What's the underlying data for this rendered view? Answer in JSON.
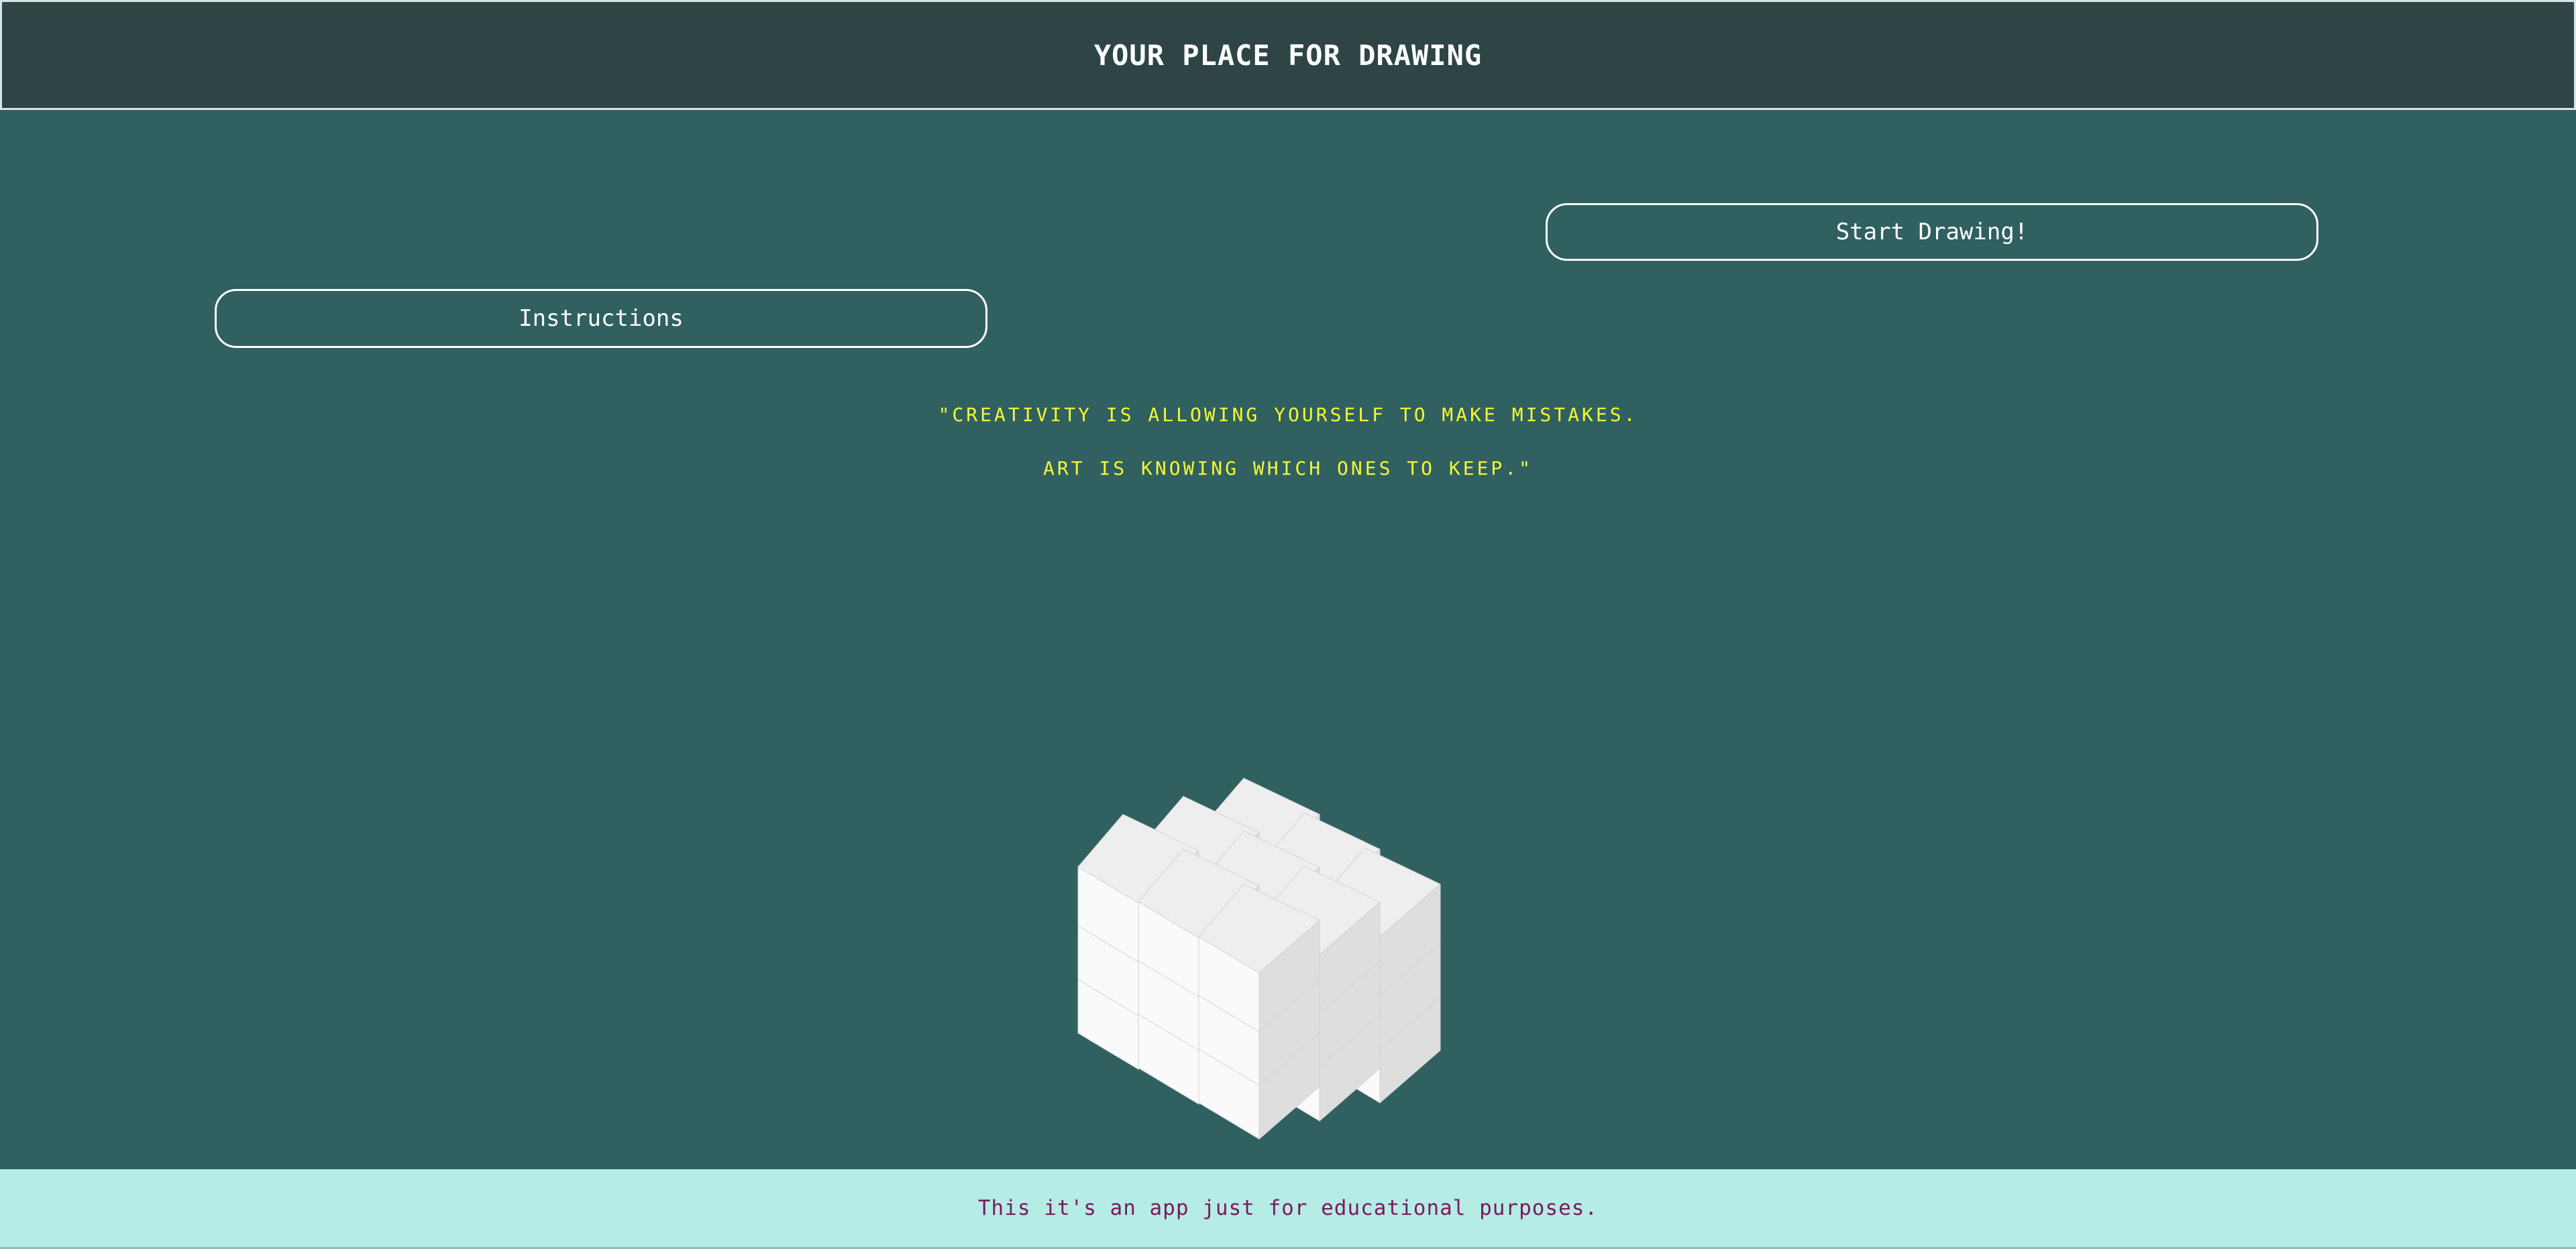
{
  "header": {
    "title": "YOUR PLACE FOR DRAWING"
  },
  "main": {
    "start_button_label": "Start Drawing!",
    "instructions_button_label": "Instructions",
    "quote_line_1": "\"CREATIVITY IS ALLOWING YOURSELF TO MAKE MISTAKES.",
    "quote_line_2": "ART IS KNOWING WHICH ONES TO KEEP.\"",
    "illustration": "isometric-cube-grid"
  },
  "footer": {
    "text": "This it's an app just for educational purposes."
  },
  "colors": {
    "header_bg": "#2f4545",
    "main_bg": "#306060",
    "quote_text": "#f4f832",
    "footer_bg": "#b5ece6",
    "footer_text": "#7a1a5c",
    "cube_top": "#eeeeee",
    "cube_left": "#fafafa",
    "cube_right": "#dedede"
  }
}
